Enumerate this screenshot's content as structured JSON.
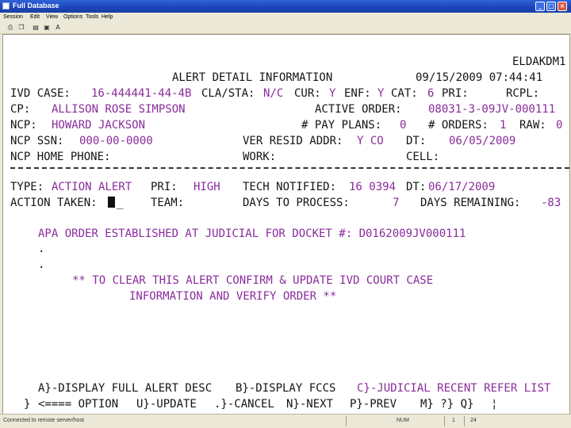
{
  "window": {
    "title": "Full Database",
    "minimize_glyph": "_",
    "maximize_glyph": "□",
    "close_glyph": "×"
  },
  "menu": [
    "Session",
    "Edit",
    "View",
    "Options",
    "Tools",
    "Help"
  ],
  "toolbar": [
    "print-icon",
    "copy-icon",
    "paste-icon",
    "disk-icon",
    "font-icon"
  ],
  "screen": {
    "screen_id": "ELDAKDM1",
    "title": "ALERT DETAIL INFORMATION",
    "datetime": "09/15/2009 07:44:41",
    "ivd_case_label": "IVD CASE:",
    "ivd_case_value": "16-444441-44-4B",
    "cla_sta_label": "CLA/STA:",
    "cla_sta_value": "N/C",
    "cur_label": "CUR:",
    "cur_value": "Y",
    "enf_label": "ENF:",
    "enf_value": "Y",
    "cat_label": "CAT:",
    "cat_value": "6",
    "pri_label": "PRI:",
    "rcpl_label": "RCPL:",
    "cp_label": "CP:",
    "cp_value": "ALLISON ROSE SIMPSON",
    "active_order_label": "ACTIVE ORDER:",
    "active_order_value": "08031-3-09JV-000111",
    "ncp_label": "NCP:",
    "ncp_value": "HOWARD JACKSON",
    "pay_plans_label": "# PAY PLANS:",
    "pay_plans_value": "0",
    "orders_label": "# ORDERS:",
    "orders_value": "1",
    "raw_label": "RAW:",
    "raw_value": "0",
    "ncp_ssn_label": "NCP SSN:",
    "ncp_ssn_value": "000-00-0000",
    "ver_resid_label": "VER RESID ADDR:",
    "ver_resid_value": "Y CO",
    "dt_label": "DT:",
    "dt_value": "06/05/2009",
    "ncp_home_phone_label": "NCP HOME PHONE:",
    "work_label": "WORK:",
    "cell_label": "CELL:",
    "type_label": "TYPE:",
    "type_value": "ACTION ALERT",
    "alert_pri_label": "PRI:",
    "alert_pri_value": "HIGH",
    "tech_notified_label": "TECH NOTIFIED:",
    "tech_notified_value": "16 0394",
    "dt2_label": "DT:",
    "dt2_value": "06/17/2009",
    "action_taken_label": "ACTION TAKEN:",
    "action_taken_value": "_",
    "team_label": "TEAM:",
    "days_to_process_label": "DAYS TO PROCESS:",
    "days_to_process_value": "7",
    "days_remaining_label": "DAYS REMAINING:",
    "days_remaining_value": "-83",
    "message_line": "APA ORDER ESTABLISHED AT JUDICIAL FOR DOCKET #: D0162009JV000111",
    "dot1": ".",
    "dot2": ".",
    "instruction_1": "** TO CLEAR THIS ALERT CONFIRM & UPDATE IVD COURT CASE",
    "instruction_2": "INFORMATION AND VERIFY ORDER **",
    "opt_a": "A}-DISPLAY FULL ALERT DESC",
    "opt_b": "B}-DISPLAY FCCS",
    "opt_c": "C}-JUDICIAL RECENT REFER LIST",
    "cmd_prefix": "}",
    "cmd_option": "<==== OPTION",
    "cmd_update": "U}-UPDATE",
    "cmd_cancel": ".}-CANCEL",
    "cmd_next": "N}-NEXT",
    "cmd_prev": "P}-PREV",
    "cmd_misc": "M} ?} Q}",
    "cmd_bar": "¦"
  },
  "status": {
    "message": "Connected to remote server/host",
    "seg2": "NUM",
    "seg3": "1",
    "seg4": "24"
  },
  "colors": {
    "field_value": "#8a2c9c",
    "label": "#141414",
    "chrome": "#ece9d8",
    "titlebar": "#1a44b8"
  }
}
